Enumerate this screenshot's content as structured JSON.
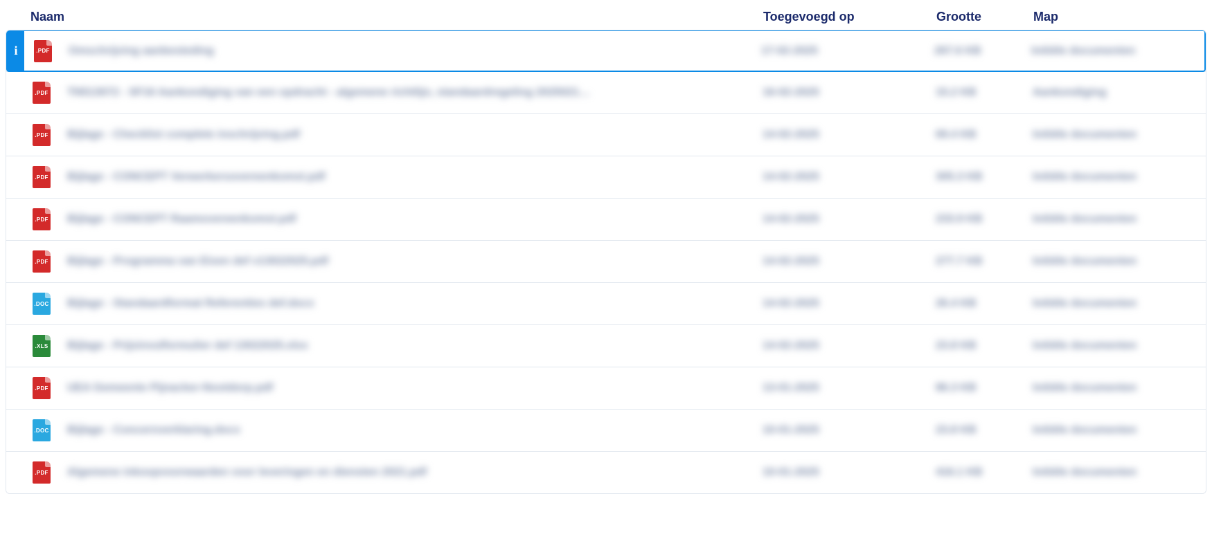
{
  "columns": {
    "name": "Naam",
    "date": "Toegevoegd op",
    "size": "Grootte",
    "map": "Map"
  },
  "info_glyph": "i",
  "icon_colors": {
    "pdf": "#d32a2a",
    "doc": "#2aa8e0",
    "xls": "#2a8a3a"
  },
  "rows": [
    {
      "type": "pdf",
      "ext": ".PDF",
      "name": "Omschrijving aanbesteding",
      "date": "17-02-2025",
      "size": "267.6 KB",
      "map": "Initiële documenten",
      "selected": true
    },
    {
      "type": "pdf",
      "ext": ".PDF",
      "name": "TN513072 - SF16 Aankondiging van een opdracht - algemene richtlijn, standaardregeling 2025021…",
      "date": "16-02-2025",
      "size": "15.2 KB",
      "map": "Aankondiging",
      "selected": false
    },
    {
      "type": "pdf",
      "ext": ".PDF",
      "name": "Bijlage - Checklist complete inschrijving.pdf",
      "date": "14-02-2025",
      "size": "69.4 KB",
      "map": "Initiële documenten",
      "selected": false
    },
    {
      "type": "pdf",
      "ext": ".PDF",
      "name": "Bijlage - CONCEPT Verwerkersovereenkomst.pdf",
      "date": "14-02-2025",
      "size": "305.3 KB",
      "map": "Initiële documenten",
      "selected": false
    },
    {
      "type": "pdf",
      "ext": ".PDF",
      "name": "Bijlage - CONCEPT Raamovereenkomst.pdf",
      "date": "14-02-2025",
      "size": "233.9 KB",
      "map": "Initiële documenten",
      "selected": false
    },
    {
      "type": "pdf",
      "ext": ".PDF",
      "name": "Bijlage - Programma van Eisen def v13022025.pdf",
      "date": "14-02-2025",
      "size": "277.7 KB",
      "map": "Initiële documenten",
      "selected": false
    },
    {
      "type": "doc",
      "ext": ".DOC",
      "name": "Bijlage - Standaardformat Referenties def.docx",
      "date": "14-02-2025",
      "size": "26.4 KB",
      "map": "Initiële documenten",
      "selected": false
    },
    {
      "type": "xls",
      "ext": ".XLS",
      "name": "Bijlage - Prijsinvulformulier def 13022025.xlsx",
      "date": "14-02-2025",
      "size": "23.8 KB",
      "map": "Initiële documenten",
      "selected": false
    },
    {
      "type": "pdf",
      "ext": ".PDF",
      "name": "UEA Gemeente Pijnacker-Nootdorp.pdf",
      "date": "13-01-2025",
      "size": "86.3 KB",
      "map": "Initiële documenten",
      "selected": false
    },
    {
      "type": "doc",
      "ext": ".DOC",
      "name": "Bijlage - Concernverklaring.docx",
      "date": "10-01-2025",
      "size": "23.8 KB",
      "map": "Initiële documenten",
      "selected": false
    },
    {
      "type": "pdf",
      "ext": ".PDF",
      "name": "Algemene inkoopvoorwaarden voor leveringen en diensten 2021.pdf",
      "date": "10-01-2025",
      "size": "416.1 KB",
      "map": "Initiële documenten",
      "selected": false
    }
  ]
}
